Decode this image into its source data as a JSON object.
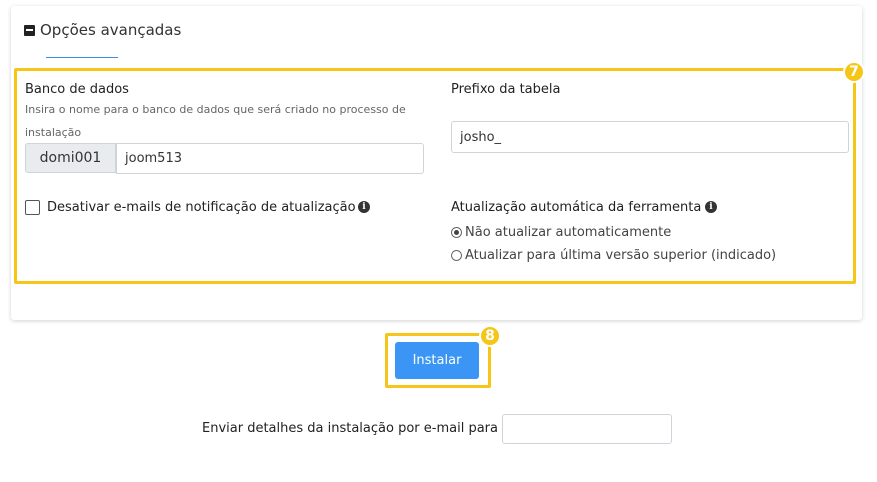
{
  "advanced": {
    "toggle_label": "Opções avançadas"
  },
  "badges": {
    "section": "7",
    "install": "8"
  },
  "database": {
    "label": "Banco de dados",
    "help": "Insira o nome para o banco de dados que será criado no processo de instalação",
    "prefix": "domi001",
    "value": "joom513"
  },
  "table_prefix": {
    "label": "Prefixo da tabela",
    "value": "josho_"
  },
  "disable_emails": {
    "label": "Desativar e-mails de notificação de atualização",
    "checked": false
  },
  "auto_update": {
    "label": "Atualização automática da ferramenta",
    "options": [
      {
        "label": "Não atualizar automaticamente",
        "selected": true
      },
      {
        "label": "Atualizar para última versão superior (indicado)",
        "selected": false
      }
    ]
  },
  "install_button": "Instalar",
  "email_details": {
    "label": "Enviar detalhes da instalação por e-mail para :",
    "value": ""
  },
  "colors": {
    "highlight": "#f5c518",
    "button": "#3b95f5"
  }
}
